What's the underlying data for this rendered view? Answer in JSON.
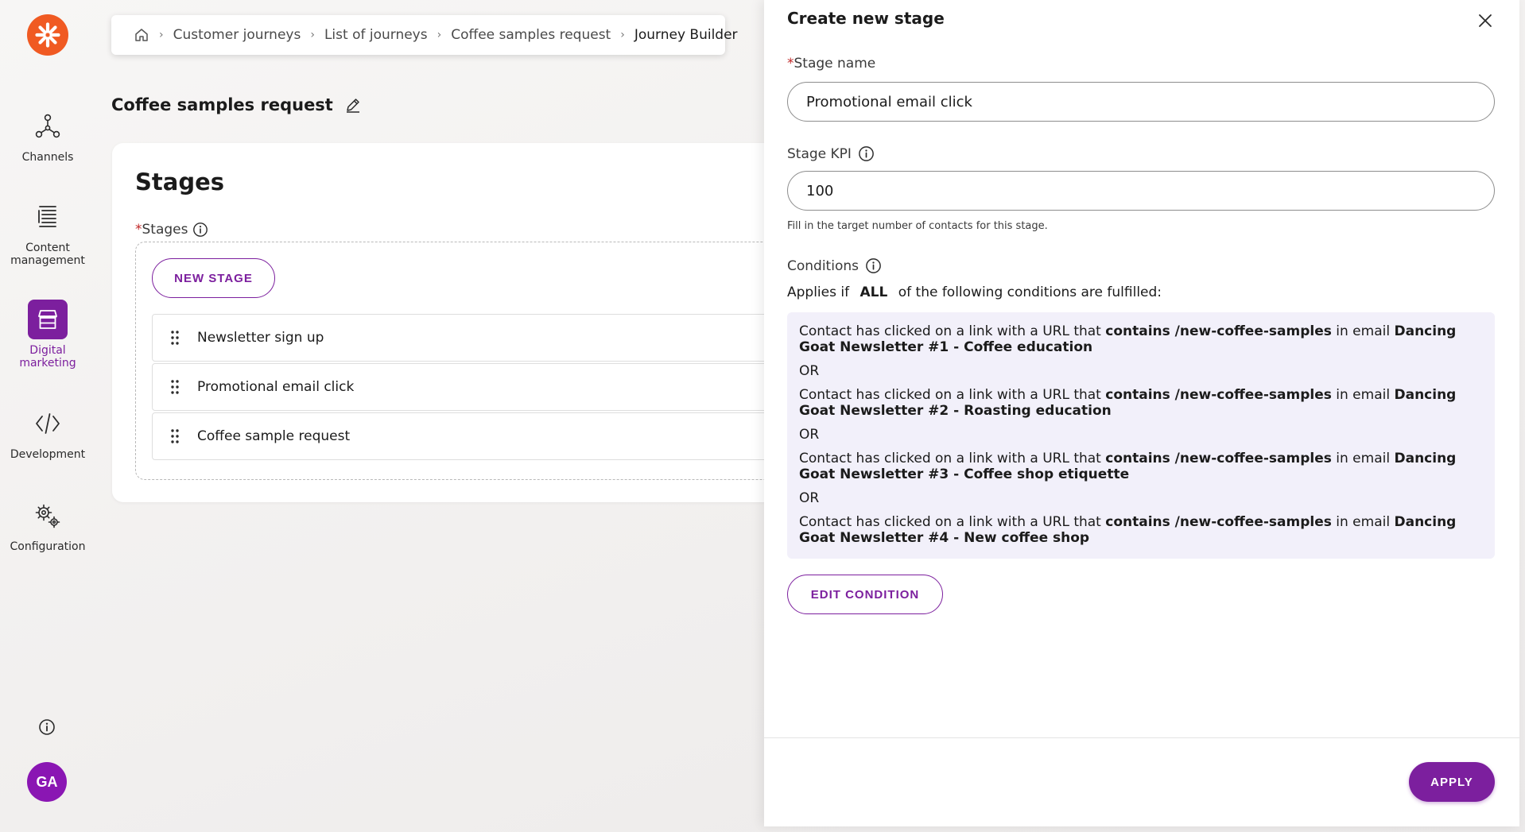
{
  "nav": {
    "items": [
      {
        "label": "Channels",
        "icon": "channels-icon"
      },
      {
        "label": "Content management",
        "icon": "content-management-icon"
      },
      {
        "label": "Digital marketing",
        "icon": "digital-marketing-icon",
        "active": true
      },
      {
        "label": "Development",
        "icon": "code-icon"
      },
      {
        "label": "Configuration",
        "icon": "gears-icon"
      }
    ],
    "avatar_initials": "GA"
  },
  "breadcrumb": {
    "items": [
      "Customer journeys",
      "List of journeys",
      "Coffee samples request",
      "Journey Builder"
    ]
  },
  "page": {
    "title": "Coffee samples request"
  },
  "stages_card": {
    "title": "Stages",
    "label_required": "*",
    "label": "Stages",
    "new_stage_button": "NEW STAGE",
    "stages": [
      "Newsletter sign up",
      "Promotional email click",
      "Coffee sample request"
    ]
  },
  "panel": {
    "title": "Create new stage",
    "stage_name_required": "*",
    "stage_name_label": "Stage name",
    "stage_name_value": "Promotional email click",
    "stage_kpi_label": "Stage KPI",
    "stage_kpi_value": "100",
    "stage_kpi_hint": "Fill in the target number of contacts for this stage.",
    "conditions_label": "Conditions",
    "applies_prefix": "Applies if",
    "applies_operator": "ALL",
    "applies_suffix": "of the following conditions are fulfilled:",
    "conditions": [
      {
        "prefix": "Contact has clicked on a link with a URL that",
        "match": "contains /new-coffee-samples",
        "middle": "in email",
        "email": "Dancing Goat Newsletter #1 - Coffee education"
      },
      {
        "prefix": "Contact has clicked on a link with a URL that",
        "match": "contains /new-coffee-samples",
        "middle": "in email",
        "email": "Dancing Goat Newsletter #2 - Roasting education"
      },
      {
        "prefix": "Contact has clicked on a link with a URL that",
        "match": "contains /new-coffee-samples",
        "middle": "in email",
        "email": "Dancing Goat Newsletter #3 - Coffee shop etiquette"
      },
      {
        "prefix": "Contact has clicked on a link with a URL that",
        "match": "contains /new-coffee-samples",
        "middle": "in email",
        "email": "Dancing Goat Newsletter #4 - New coffee shop"
      }
    ],
    "or_label": "OR",
    "edit_condition_button": "EDIT CONDITION",
    "apply_button": "APPLY"
  },
  "colors": {
    "accent": "#7c1f9e",
    "logo": "#f05a22",
    "avatar": "#8a16b3",
    "conditions_bg": "#f2f0fa",
    "required": "#c02626"
  }
}
